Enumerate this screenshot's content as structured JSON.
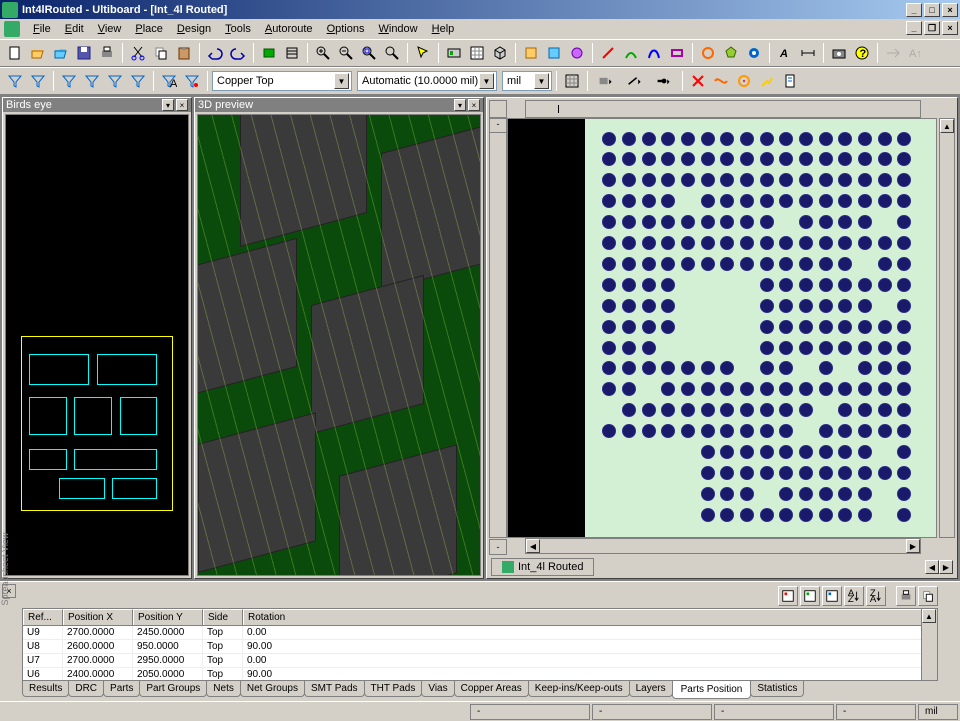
{
  "window": {
    "title": "Int4lRouted - Ultiboard - [Int_4l Routed]",
    "min": "_",
    "max": "□",
    "close": "×"
  },
  "menu": {
    "items": [
      "File",
      "Edit",
      "View",
      "Place",
      "Design",
      "Tools",
      "Autoroute",
      "Options",
      "Window",
      "Help"
    ]
  },
  "toolbar2": {
    "layer_combo": "Copper Top",
    "grid_combo": "Automatic (10.0000 mil)",
    "unit_combo": "mil"
  },
  "panels": {
    "birds_eye": "Birds eye",
    "preview3d": "3D preview"
  },
  "doc_tab": "Int_4l Routed",
  "grid": {
    "headers": [
      "Ref...",
      "Position X",
      "Position Y",
      "Side",
      "Rotation"
    ],
    "rows": [
      {
        "ref": "U9",
        "px": "2700.0000",
        "py": "2450.0000",
        "side": "Top",
        "rot": "0.00"
      },
      {
        "ref": "U8",
        "px": "2600.0000",
        "py": "950.0000",
        "side": "Top",
        "rot": "90.00"
      },
      {
        "ref": "U7",
        "px": "2700.0000",
        "py": "2950.0000",
        "side": "Top",
        "rot": "0.00"
      },
      {
        "ref": "U6",
        "px": "2400.0000",
        "py": "2050.0000",
        "side": "Top",
        "rot": "90.00"
      }
    ]
  },
  "bottom_tabs": [
    "Results",
    "DRC",
    "Parts",
    "Part Groups",
    "Nets",
    "Net Groups",
    "SMT Pads",
    "THT Pads",
    "Vias",
    "Copper Areas",
    "Keep-ins/Keep-outs",
    "Layers",
    "Parts Position",
    "Statistics"
  ],
  "bottom_active": "Parts Position",
  "side_label": "Spreadsheet View",
  "status": {
    "c1": "-",
    "c2": "-",
    "c3": "-",
    "c4": "-",
    "unit": "mil"
  }
}
